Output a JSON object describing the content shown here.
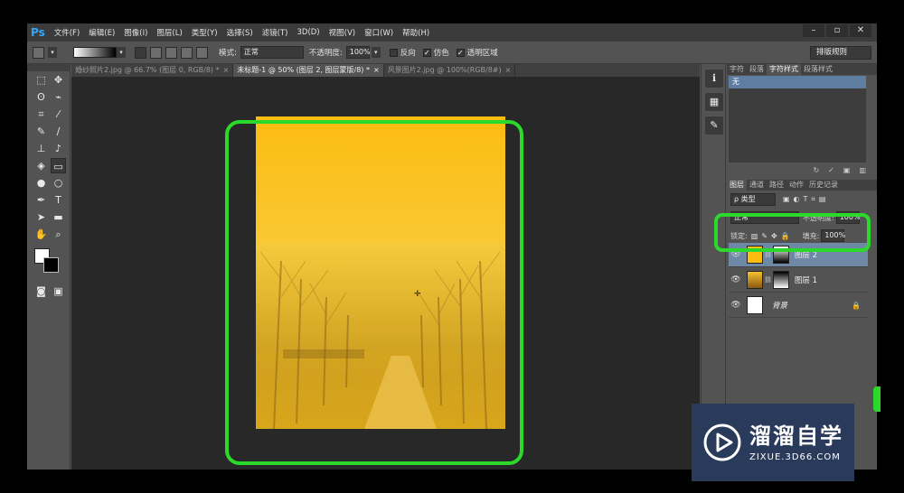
{
  "app": {
    "logo": "Ps",
    "menu": [
      "文件(F)",
      "编辑(E)",
      "图像(I)",
      "图层(L)",
      "类型(Y)",
      "选择(S)",
      "滤镜(T)",
      "3D(D)",
      "视图(V)",
      "窗口(W)",
      "帮助(H)"
    ],
    "window_controls": [
      "–",
      "▫",
      "✕"
    ]
  },
  "options": {
    "mode_label": "模式:",
    "mode_value": "正常",
    "opacity_label": "不透明度:",
    "opacity_value": "100%",
    "reverse_label": "反向",
    "dither_label": "仿色",
    "transparency_label": "透明区域",
    "workspace_value": "排版规则"
  },
  "doc_tabs": [
    {
      "label": "婚纱照片2.jpg @ 66.7% (图层 0, RGB/8) *",
      "close": "×"
    },
    {
      "label": "未标题-1 @ 50% (图层 2, 图层蒙版/8) *",
      "close": "×"
    },
    {
      "label": "风景图片2.jpg @ 100%(RGB/8#)",
      "close": "×"
    }
  ],
  "panels": {
    "char_tabs": [
      "字符",
      "段落",
      "字符样式",
      "段落样式"
    ],
    "style_selected": "无",
    "layer_tabs": [
      "图层",
      "通道",
      "路径",
      "动作",
      "历史记录"
    ],
    "kind_label": "ρ 类型",
    "blend_mode": "正常",
    "opacity_label": "不透明度:",
    "opacity_value": "100%",
    "lock_label": "锁定:",
    "fill_label": "填充:",
    "fill_value": "100%",
    "layers": [
      {
        "name": "图层 2"
      },
      {
        "name": "图层 1"
      },
      {
        "name": "背景"
      }
    ]
  },
  "watermark": {
    "title": "溜溜自学",
    "url": "ZIXUE.3D66.COM"
  },
  "colors": {
    "highlight": "#2bd92b",
    "layer_selected": "#6f88a6",
    "canvas_top": "#fcbc12"
  }
}
